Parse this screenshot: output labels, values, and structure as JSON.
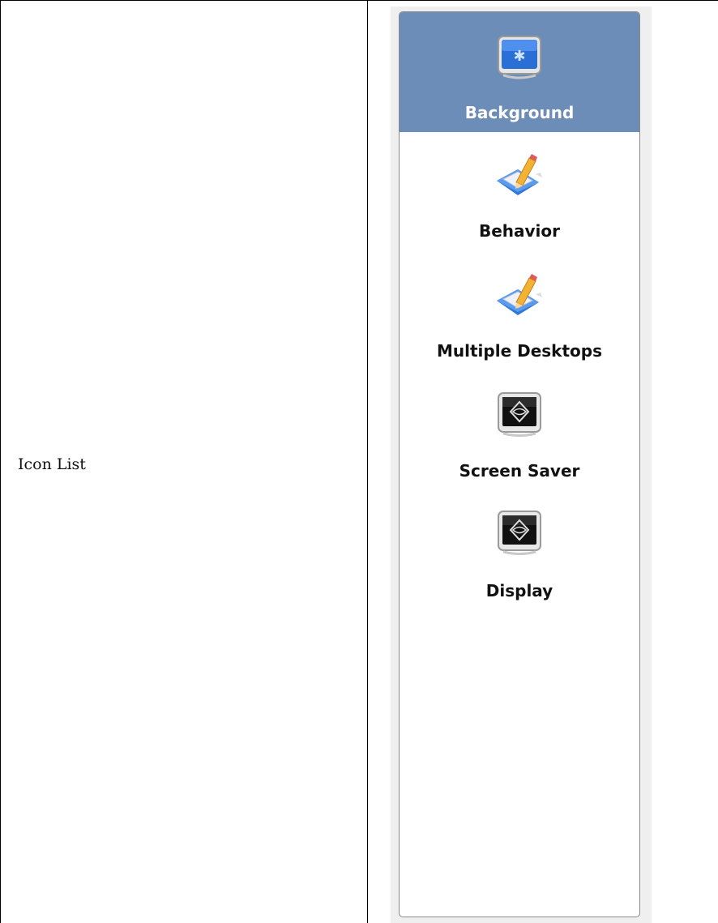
{
  "doc": {
    "label": "Icon List"
  },
  "icon_list": {
    "items": [
      {
        "label": "Background",
        "icon": "kde-desktop-background-icon",
        "selected": true
      },
      {
        "label": "Behavior",
        "icon": "pencil-document-icon",
        "selected": false
      },
      {
        "label": "Multiple Desktops",
        "icon": "pencil-document-icon",
        "selected": false
      },
      {
        "label": "Screen Saver",
        "icon": "monitor-screensaver-icon",
        "selected": false
      },
      {
        "label": "Display",
        "icon": "monitor-screensaver-icon",
        "selected": false
      }
    ],
    "selection_color": "#6b8db7"
  }
}
